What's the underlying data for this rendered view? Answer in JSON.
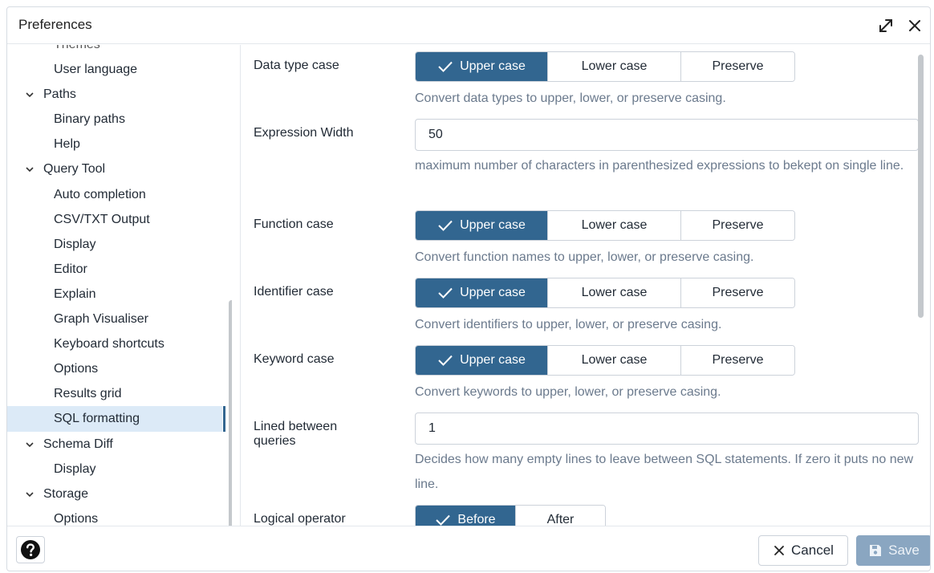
{
  "dialog": {
    "title": "Preferences"
  },
  "tree": {
    "items": [
      {
        "label": "Themes",
        "level": "child",
        "cut": true
      },
      {
        "label": "User language",
        "level": "child"
      },
      {
        "label": "Paths",
        "level": "parent"
      },
      {
        "label": "Binary paths",
        "level": "child"
      },
      {
        "label": "Help",
        "level": "child"
      },
      {
        "label": "Query Tool",
        "level": "parent"
      },
      {
        "label": "Auto completion",
        "level": "child"
      },
      {
        "label": "CSV/TXT Output",
        "level": "child"
      },
      {
        "label": "Display",
        "level": "child"
      },
      {
        "label": "Editor",
        "level": "child"
      },
      {
        "label": "Explain",
        "level": "child"
      },
      {
        "label": "Graph Visualiser",
        "level": "child"
      },
      {
        "label": "Keyboard shortcuts",
        "level": "child"
      },
      {
        "label": "Options",
        "level": "child"
      },
      {
        "label": "Results grid",
        "level": "child"
      },
      {
        "label": "SQL formatting",
        "level": "child",
        "selected": true
      },
      {
        "label": "Schema Diff",
        "level": "parent"
      },
      {
        "label": "Display",
        "level": "child"
      },
      {
        "label": "Storage",
        "level": "parent"
      },
      {
        "label": "Options",
        "level": "child"
      }
    ]
  },
  "form": {
    "data_type_case": {
      "label": "Data type case",
      "options": [
        "Upper case",
        "Lower case",
        "Preserve"
      ],
      "selected": "Upper case",
      "help": "Convert data types to upper, lower, or preserve casing."
    },
    "expression_width": {
      "label": "Expression Width",
      "value": "50",
      "help": "maximum number of characters in parenthesized expressions to bekept on single line."
    },
    "function_case": {
      "label": "Function case",
      "options": [
        "Upper case",
        "Lower case",
        "Preserve"
      ],
      "selected": "Upper case",
      "help": "Convert function names to upper, lower, or preserve casing."
    },
    "identifier_case": {
      "label": "Identifier case",
      "options": [
        "Upper case",
        "Lower case",
        "Preserve"
      ],
      "selected": "Upper case",
      "help": "Convert identifiers to upper, lower, or preserve casing."
    },
    "keyword_case": {
      "label": "Keyword case",
      "options": [
        "Upper case",
        "Lower case",
        "Preserve"
      ],
      "selected": "Upper case",
      "help": "Convert keywords to upper, lower, or preserve casing."
    },
    "lines_between_queries": {
      "label_line1": "Lined between",
      "label_line2": "queries",
      "value": "1",
      "help": "Decides how many empty lines to leave between SQL statements. If zero it puts no new line."
    },
    "logical_operator": {
      "label": "Logical operator",
      "options": [
        "Before",
        "After"
      ],
      "selected": "Before"
    }
  },
  "footer": {
    "cancel_label": "Cancel",
    "save_label": "Save"
  },
  "colors": {
    "accent": "#326690",
    "selected_bg": "#dceaf7",
    "help_text": "#6b7a8d",
    "save_disabled": "#8aa6c1"
  },
  "icons": {
    "expand": "expand-icon",
    "close": "close-icon",
    "help": "help-circle-icon",
    "cancel": "x-icon",
    "save": "floppy-icon",
    "check": "check-icon",
    "caret": "chevron-down-icon"
  }
}
